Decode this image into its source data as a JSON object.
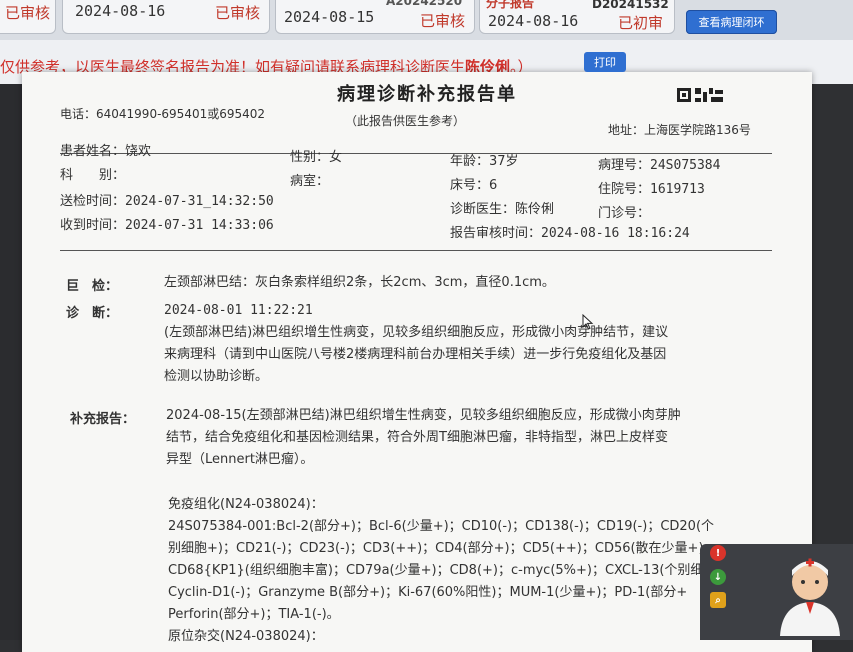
{
  "top_cards": [
    {
      "status": "已审核",
      "date": "2024-08-16",
      "status2": "已审核",
      "code": "",
      "tag": ""
    },
    {
      "date": "2024-08-15",
      "status": "已审核",
      "code": "A20242520"
    },
    {
      "tag": "分子报告",
      "date": "2024-08-16",
      "code": "D20241532",
      "status": "已初审"
    }
  ],
  "closed_loop_button": "查看病理闭环",
  "notice": {
    "text_before": "仅供参考，以医生最终签名报告为准！如有疑问请联系病理科诊断医生",
    "doctor": "陈伶俐",
    "text_after": "。）"
  },
  "print_button": "打印",
  "report": {
    "title": "病理诊断补充报告单",
    "phone": "电话：64041990-695401或695402",
    "subtitle": "（此报告供医生参考）",
    "address": "地址：上海医学院路136号",
    "patient_name_label": "患者姓名：",
    "patient_name": "饶欢",
    "department_label": "科　　别：",
    "gender_label": "性别：",
    "gender": "女",
    "ward_label": "病室：",
    "age_label": "年龄：",
    "age": "37岁",
    "bed_label": "床号：",
    "bed": "6",
    "doctor_label": "诊断医生：",
    "doctor": "陈伶俐",
    "review_time_label": "报告审核时间：",
    "review_time": "2024-08-16 18:16:24",
    "path_no_label": "病理号：",
    "path_no": "24S075384",
    "admission_no_label": "住院号：",
    "admission_no": "1619713",
    "clinic_no_label": "门诊号：",
    "submit_time_label": "送检时间：",
    "submit_time": "2024-07-31_14:32:50",
    "receive_time_label": "收到时间：",
    "receive_time": "2024-07-31 14:33:06",
    "gross_label": "巨　检：",
    "gross_text": "左颈部淋巴结：灰白条索样组织2条，长2cm、3cm，直径0.1cm。",
    "diagnosis_label": "诊　断：",
    "diagnosis_time": "2024-08-01 11:22:21",
    "diagnosis_lines": [
      "(左颈部淋巴结)淋巴组织增生性病变，见较多组织细胞反应，形成微小肉芽肿结节，建议",
      "来病理科（请到中山医院八号楼2楼病理科前台办理相关手续）进一步行免疫组化及基因",
      "检测以协助诊断。"
    ],
    "supplement_label": "补充报告：",
    "supplement_lines": [
      "2024-08-15(左颈部淋巴结)淋巴组织增生性病变，见较多组织细胞反应，形成微小肉芽肿",
      "结节，结合免疫组化和基因检测结果，符合外周T细胞淋巴瘤，非特指型，淋巴上皮样变",
      "异型（Lennert淋巴瘤）。"
    ],
    "ihc_title": "免疫组化(N24-038024)：",
    "ihc_lines": [
      "24S075384-001:Bcl-2(部分+)；Bcl-6(少量+)；CD10(-)；CD138(-)；CD19(-)；CD20(个",
      "别细胞+)；CD21(-)；CD23(-)；CD3(++)；CD4(部分+)；CD5(++)；CD56(散在少量+)",
      "CD68{KP1}(组织细胞丰富)；CD79a(少量+)；CD8(+)；c-myc(5%+)；CXCL-13(个别细",
      "Cyclin-D1(-)；Granzyme B(部分+)；Ki-67(60%阳性)；MUM-1(少量+)；PD-1(部分+",
      "Perforin(部分+)；TIA-1(-)。"
    ],
    "ish_title": "原位杂交(N24-038024)："
  },
  "icons": [
    "alert-icon",
    "download-icon",
    "search-icon",
    "doctor-avatar-icon",
    "qr-code-icon",
    "mouse-cursor-icon"
  ],
  "colors": {
    "accent": "#2f6fd1",
    "warning": "#d1302a",
    "background": "#2f3033"
  }
}
